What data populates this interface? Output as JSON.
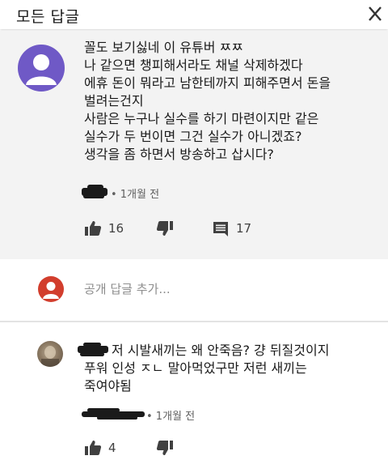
{
  "header": {
    "title": "모든 답글",
    "close_icon": "close-icon"
  },
  "comment": {
    "lines": [
      "꼴도 보기싫네 이 유튜버 ㅉㅉ",
      "나 같으면 챙피해서라도 채널 삭제하겠다",
      "에휴 돈이 뭐라고 남한테까지 피해주면서 돈을",
      "벌려는건지",
      "사람은 누구나 실수를 하기 마련이지만 같은",
      "실수가 두 번이면 그건 실수가 아니겠죠?",
      "생각을 좀 하면서 방송하고 삽시다?"
    ],
    "time": "• 1개월 전",
    "likes": "16",
    "replies": "17"
  },
  "reply_input": {
    "placeholder": "공개 답글 추가..."
  },
  "reply": {
    "lines": [
      "저 시발새끼는 왜 안죽음? 걍 뒤질것이지",
      "푸워 인성 ㅈㄴ 말아먹었구만 저런 새끼는",
      "죽여야됨"
    ],
    "time": "• 1개월 전",
    "likes": "4"
  },
  "colors": {
    "avatar_main": "#6f59c6",
    "avatar_small": "#d23e2d",
    "background_comment": "#f3f3f3",
    "text_secondary": "#606060"
  }
}
